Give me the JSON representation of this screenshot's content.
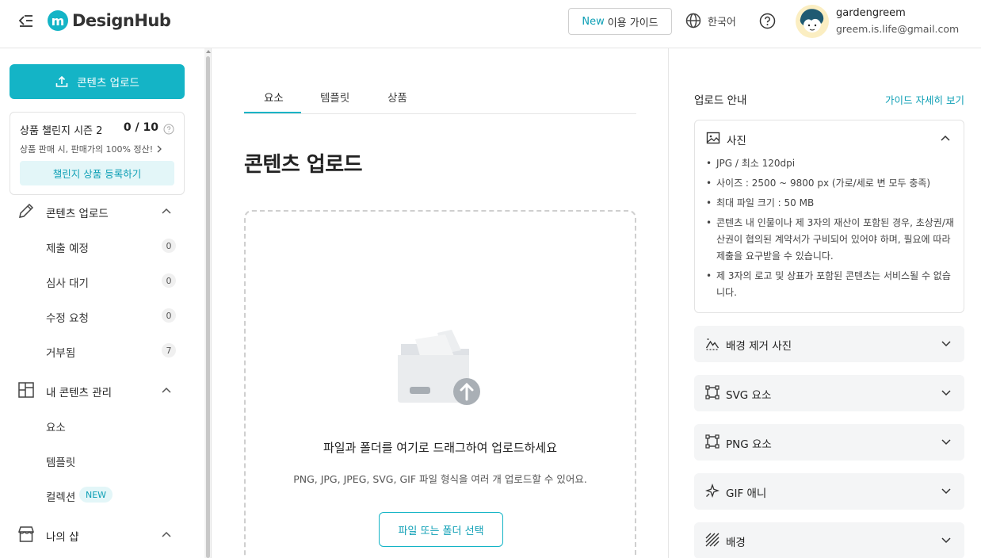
{
  "header": {
    "logo_mark": "m",
    "logo_text": "DesignHub",
    "guide_new": "New",
    "guide_label": "이용 가이드",
    "language": "한국어",
    "user_name": "gardengreem",
    "user_email": "greem.is.life@gmail.com"
  },
  "sidebar": {
    "upload_label": "콘텐츠 업로드",
    "challenge": {
      "title": "상품 챌린지 시즌 2",
      "count": "0 / 10",
      "subtitle": "상품 판매 시, 판매가의 100% 정산!",
      "button": "챌린지 상품 등록하기"
    },
    "groups": [
      {
        "label": "콘텐츠 업로드",
        "items": [
          {
            "label": "제출 예정",
            "count": "0"
          },
          {
            "label": "심사 대기",
            "count": "0"
          },
          {
            "label": "수정 요청",
            "count": "0"
          },
          {
            "label": "거부됨",
            "count": "7"
          }
        ]
      },
      {
        "label": "내 콘텐츠 관리",
        "items": [
          {
            "label": "요소"
          },
          {
            "label": "템플릿"
          },
          {
            "label": "컬렉션",
            "badge": "NEW"
          }
        ]
      },
      {
        "label": "나의 샵",
        "items": []
      }
    ]
  },
  "main": {
    "tabs": [
      "요소",
      "템플릿",
      "상품"
    ],
    "title": "콘텐츠 업로드",
    "drop_title": "파일과 폴더를 여기로 드래그하여 업로드하세요",
    "drop_sub": "PNG, JPG, JPEG, SVG, GIF 파일 형식을 여러 개 업로드할 수 있어요.",
    "select_button": "파일 또는 폴더 선택"
  },
  "guide_panel": {
    "title": "업로드 안내",
    "link": "가이드 자세히 보기",
    "photo": {
      "label": "사진",
      "rules": [
        "JPG / 최소 120dpi",
        "사이즈 : 2500 ~ 9800 px (가로/세로 변 모두 충족)",
        "최대 파일 크기 : 50 MB",
        "콘텐츠 내 인물이나 제 3자의 재산이 포함된 경우, 초상권/재산권이 협의된 계약서가 구비되어 있어야 하며, 필요에 따라 제출을 요구받을 수 있습니다.",
        "제 3자의 로고 및 상표가 포함된 콘텐츠는 서비스될 수 없습니다."
      ]
    },
    "sections": [
      {
        "label": "배경 제거 사진",
        "icon": "mountain-cutout-icon"
      },
      {
        "label": "SVG 요소",
        "icon": "vector-square-icon"
      },
      {
        "label": "PNG 요소",
        "icon": "vector-square-icon"
      },
      {
        "label": "GIF 애니",
        "icon": "sparkle-star-icon"
      },
      {
        "label": "배경",
        "icon": "pattern-lines-icon"
      }
    ]
  },
  "colors": {
    "accent": "#14b4c6",
    "accent_text": "#0d9fb5",
    "accent_light": "#e3f6f8"
  }
}
